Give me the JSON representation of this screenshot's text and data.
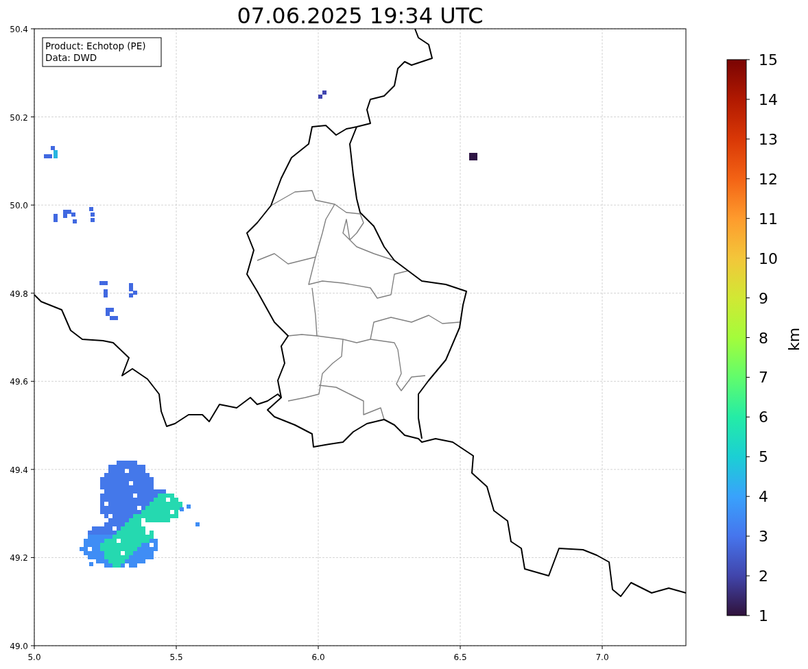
{
  "title": "07.06.2025 19:34 UTC",
  "info_box": [
    "Product: Echotop (PE)",
    "Data: DWD"
  ],
  "x_axis": {
    "ticks": [
      "5.0",
      "5.5",
      "6.0",
      "6.5",
      "7.0"
    ]
  },
  "y_axis": {
    "ticks": [
      "50.4",
      "50.2",
      "50.0",
      "49.8",
      "49.6",
      "49.4",
      "49.2",
      "49.0"
    ]
  },
  "colorbar": {
    "label": "km",
    "ticks": [
      "15",
      "14",
      "13",
      "12",
      "11",
      "10",
      "9",
      "8",
      "7",
      "6",
      "5",
      "4",
      "3",
      "2",
      "1"
    ]
  }
}
